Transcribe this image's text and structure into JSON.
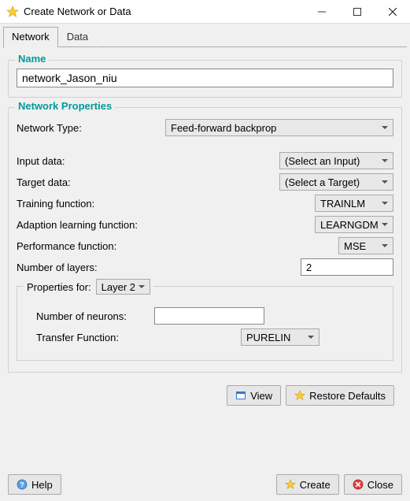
{
  "window": {
    "title": "Create Network or Data"
  },
  "tabs": {
    "network": "Network",
    "data": "Data"
  },
  "name_group": {
    "title": "Name",
    "value": "network_Jason_niu"
  },
  "props_group": {
    "title": "Network Properties",
    "network_type_label": "Network Type:",
    "network_type_value": "Feed-forward backprop",
    "input_data_label": "Input data:",
    "input_data_value": "(Select an Input)",
    "target_data_label": "Target data:",
    "target_data_value": "(Select a Target)",
    "training_fn_label": "Training function:",
    "training_fn_value": "TRAINLM",
    "adaption_fn_label": "Adaption learning function:",
    "adaption_fn_value": "LEARNGDM",
    "perf_fn_label": "Performance function:",
    "perf_fn_value": "MSE",
    "num_layers_label": "Number of layers:",
    "num_layers_value": "2",
    "layer_props": {
      "title": "Properties for:",
      "layer_select": "Layer 2",
      "num_neurons_label": "Number of neurons:",
      "num_neurons_value": "",
      "transfer_label": "Transfer Function:",
      "transfer_value": "PURELIN"
    }
  },
  "buttons": {
    "view": "View",
    "restore": "Restore Defaults",
    "help": "Help",
    "create": "Create",
    "close": "Close"
  }
}
